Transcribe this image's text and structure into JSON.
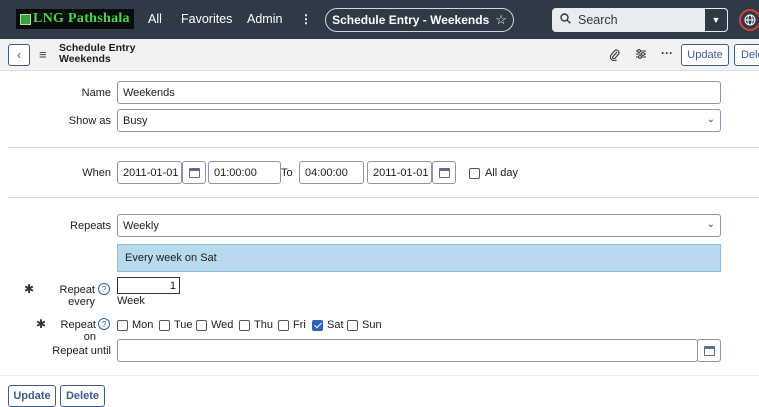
{
  "nav": {
    "logo_text": "LNG Pathshala",
    "links": [
      "All",
      "Favorites",
      "Admin"
    ],
    "record_title": "Schedule Entry - Weekends",
    "search_placeholder": "Search"
  },
  "header": {
    "title": "Schedule Entry Weekends",
    "update_label": "Update",
    "delete_label": "Dele"
  },
  "form": {
    "name_label": "Name",
    "name_value": "Weekends",
    "show_as_label": "Show as",
    "show_as_value": "Busy",
    "when_label": "When",
    "start_date": "2011-01-01",
    "start_time": "01:00:00",
    "to_label": "To",
    "end_time": "04:00:00",
    "end_date": "2011-01-01",
    "all_day_label": "All day",
    "repeats_label": "Repeats",
    "repeats_value": "Weekly",
    "repeat_summary": "Every week on Sat",
    "repeat_every_label": "Repeat every",
    "repeat_every_value": "1",
    "repeat_every_unit": "Week",
    "repeat_on_label": "Repeat on",
    "days": [
      {
        "label": "Mon",
        "checked": false
      },
      {
        "label": "Tue",
        "checked": false
      },
      {
        "label": "Wed",
        "checked": false
      },
      {
        "label": "Thu",
        "checked": false
      },
      {
        "label": "Fri",
        "checked": false
      },
      {
        "label": "Sat",
        "checked": true
      },
      {
        "label": "Sun",
        "checked": false
      }
    ],
    "repeat_until_label": "Repeat until",
    "repeat_until_value": ""
  },
  "footer": {
    "update_label": "Update",
    "delete_label": "Delete"
  },
  "icons": [
    "search-icon",
    "star-icon",
    "globe-icon",
    "back-icon",
    "menu-icon",
    "attachment-icon",
    "settings-icon",
    "more-icon",
    "calendar-icon",
    "help-icon"
  ],
  "colors": {
    "nav_bg": "#2e3a45",
    "accent": "#3e5a8f",
    "info_bg": "#b9d9ee",
    "checked": "#2f62b2"
  }
}
